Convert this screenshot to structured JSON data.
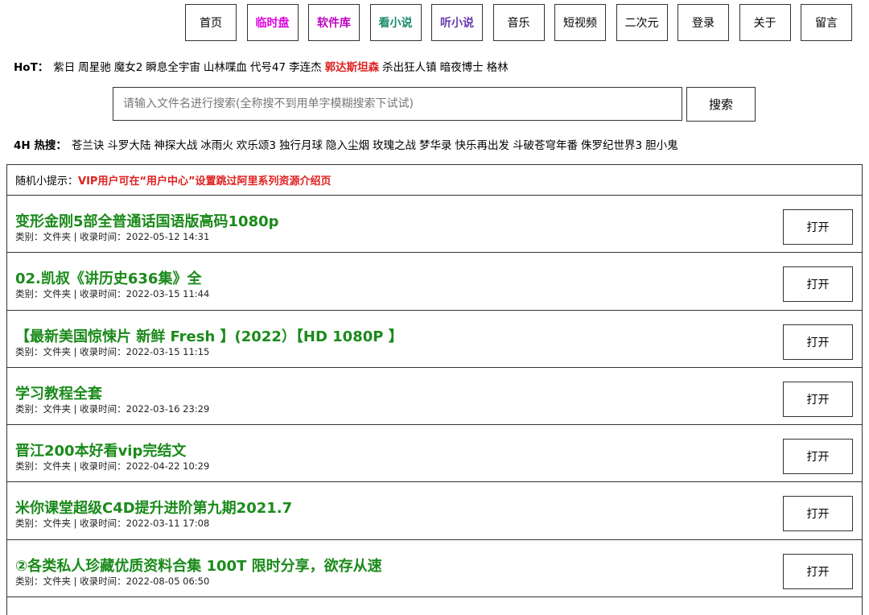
{
  "nav": [
    {
      "label": "首页",
      "color": "#000000",
      "bold": false
    },
    {
      "label": "临时盘",
      "color": "#e000e0",
      "bold": true
    },
    {
      "label": "软件库",
      "color": "#c000c0",
      "bold": true
    },
    {
      "label": "看小说",
      "color": "#1a8a6a",
      "bold": true
    },
    {
      "label": "听小说",
      "color": "#6a3ab0",
      "bold": true
    },
    {
      "label": "音乐",
      "color": "#000000",
      "bold": false
    },
    {
      "label": "短视频",
      "color": "#000000",
      "bold": false
    },
    {
      "label": "二次元",
      "color": "#000000",
      "bold": false
    },
    {
      "label": "登录",
      "color": "#000000",
      "bold": false
    },
    {
      "label": "关于",
      "color": "#000000",
      "bold": false
    },
    {
      "label": "留言",
      "color": "#000000",
      "bold": false
    }
  ],
  "hot": {
    "label": "HoT：",
    "keywords": [
      {
        "text": "紫日",
        "highlight": false
      },
      {
        "text": "周星驰",
        "highlight": false
      },
      {
        "text": "魔女2",
        "highlight": false
      },
      {
        "text": "瞬息全宇宙",
        "highlight": false
      },
      {
        "text": "山林喋血",
        "highlight": false
      },
      {
        "text": "代号47",
        "highlight": false
      },
      {
        "text": "李连杰",
        "highlight": false
      },
      {
        "text": "郭达斯坦森",
        "highlight": true
      },
      {
        "text": "杀出狂人镇",
        "highlight": false
      },
      {
        "text": "暗夜博士",
        "highlight": false
      },
      {
        "text": "格林",
        "highlight": false
      }
    ]
  },
  "search": {
    "placeholder": "请输入文件名进行搜索(全称搜不到用单字模糊搜索下试试)",
    "button_label": "搜索"
  },
  "hot4h": {
    "label": "4H 热搜：",
    "keywords": [
      "苍兰诀",
      "斗罗大陆",
      "神探大战",
      "冰雨火",
      "欢乐颂3",
      "独行月球",
      "隐入尘烟",
      "玫瑰之战",
      "梦华录",
      "快乐再出发",
      "斗破苍穹年番",
      "侏罗纪世界3",
      "胆小鬼"
    ]
  },
  "tip": {
    "label": "随机小提示：",
    "text": "VIP用户可在“用户中心”设置跳过阿里系列资源介绍页"
  },
  "items": [
    {
      "title": "变形金刚5部全普通话国语版高码1080p",
      "meta": "类别：文件夹 | 收录时间：2022-05-12 14:31",
      "button": "打开"
    },
    {
      "title": "02.凯叔《讲历史636集》全",
      "meta": "类别：文件夹 | 收录时间：2022-03-15 11:44",
      "button": "打开"
    },
    {
      "title": "【最新美国惊悚片 新鲜 Fresh 】(2022）【HD 1080P 】",
      "meta": "类别：文件夹 | 收录时间：2022-03-15 11:15",
      "button": "打开"
    },
    {
      "title": "学习教程全套",
      "meta": "类别：文件夹 | 收录时间：2022-03-16 23:29",
      "button": "打开"
    },
    {
      "title": "晋江200本好看vip完结文",
      "meta": "类别：文件夹 | 收录时间：2022-04-22 10:29",
      "button": "打开"
    },
    {
      "title": "米你课堂超级C4D提升进阶第九期2021.7",
      "meta": "类别：文件夹 | 收录时间：2022-03-11 17:08",
      "button": "打开"
    },
    {
      "title": "②各类私人珍藏优质资料合集 100T 限时分享，欲存从速",
      "meta": "类别：文件夹 | 收录时间：2022-08-05 06:50",
      "button": "打开"
    }
  ]
}
